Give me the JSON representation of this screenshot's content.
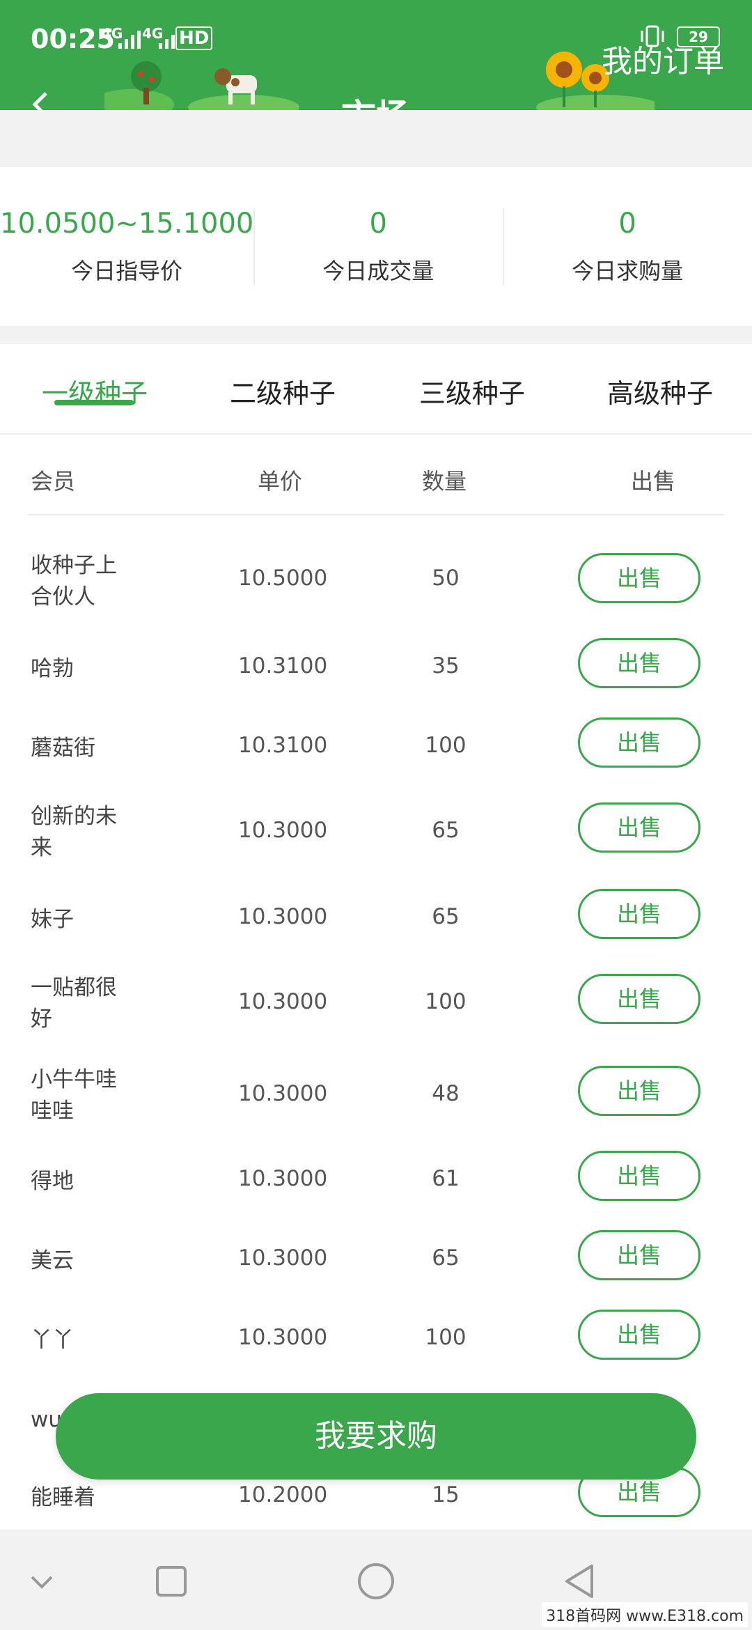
{
  "status_bar": {
    "time": "00:25",
    "network_1": "4G",
    "network_2": "4G",
    "hd": "HD",
    "battery": "29"
  },
  "header": {
    "title": "市场",
    "orders_link": "我的订单",
    "back_icon": "chevron-left-icon"
  },
  "stats": [
    {
      "value": "10.0500~15.1000",
      "label": "今日指导价"
    },
    {
      "value": "0",
      "label": "今日成交量"
    },
    {
      "value": "0",
      "label": "今日求购量"
    }
  ],
  "tabs": [
    {
      "label": "一级种子",
      "active": true
    },
    {
      "label": "二级种子",
      "active": false
    },
    {
      "label": "三级种子",
      "active": false
    },
    {
      "label": "高级种子",
      "active": false
    }
  ],
  "table": {
    "headers": {
      "member": "会员",
      "price": "单价",
      "qty": "数量",
      "action": "出售"
    },
    "rows": [
      {
        "member": "收种子上合伙人",
        "price": "10.5000",
        "qty": "50",
        "action": "出售"
      },
      {
        "member": "哈勃",
        "price": "10.3100",
        "qty": "35",
        "action": "出售"
      },
      {
        "member": "蘑菇街",
        "price": "10.3100",
        "qty": "100",
        "action": "出售"
      },
      {
        "member": "创新的未来",
        "price": "10.3000",
        "qty": "65",
        "action": "出售"
      },
      {
        "member": "妹子",
        "price": "10.3000",
        "qty": "65",
        "action": "出售"
      },
      {
        "member": "一贴都很好",
        "price": "10.3000",
        "qty": "100",
        "action": "出售"
      },
      {
        "member": "小牛牛哇哇哇",
        "price": "10.3000",
        "qty": "48",
        "action": "出售"
      },
      {
        "member": "得地",
        "price": "10.3000",
        "qty": "61",
        "action": "出售"
      },
      {
        "member": "美云",
        "price": "10.3000",
        "qty": "65",
        "action": "出售"
      },
      {
        "member": "丫丫",
        "price": "10.3000",
        "qty": "100",
        "action": "出售"
      },
      {
        "member": "wu",
        "price": "",
        "qty": "",
        "action": ""
      },
      {
        "member": "能睡着",
        "price": "10.2000",
        "qty": "15",
        "action": "出售"
      }
    ]
  },
  "buy_button": "我要求购",
  "navbar": {
    "icons": [
      "chevron-down-icon",
      "square-icon",
      "circle-icon",
      "triangle-back-icon"
    ]
  },
  "watermark": "318首码网 www.E318.com",
  "colors": {
    "accent": "#3aa74c",
    "background": "#f2f2f2"
  }
}
